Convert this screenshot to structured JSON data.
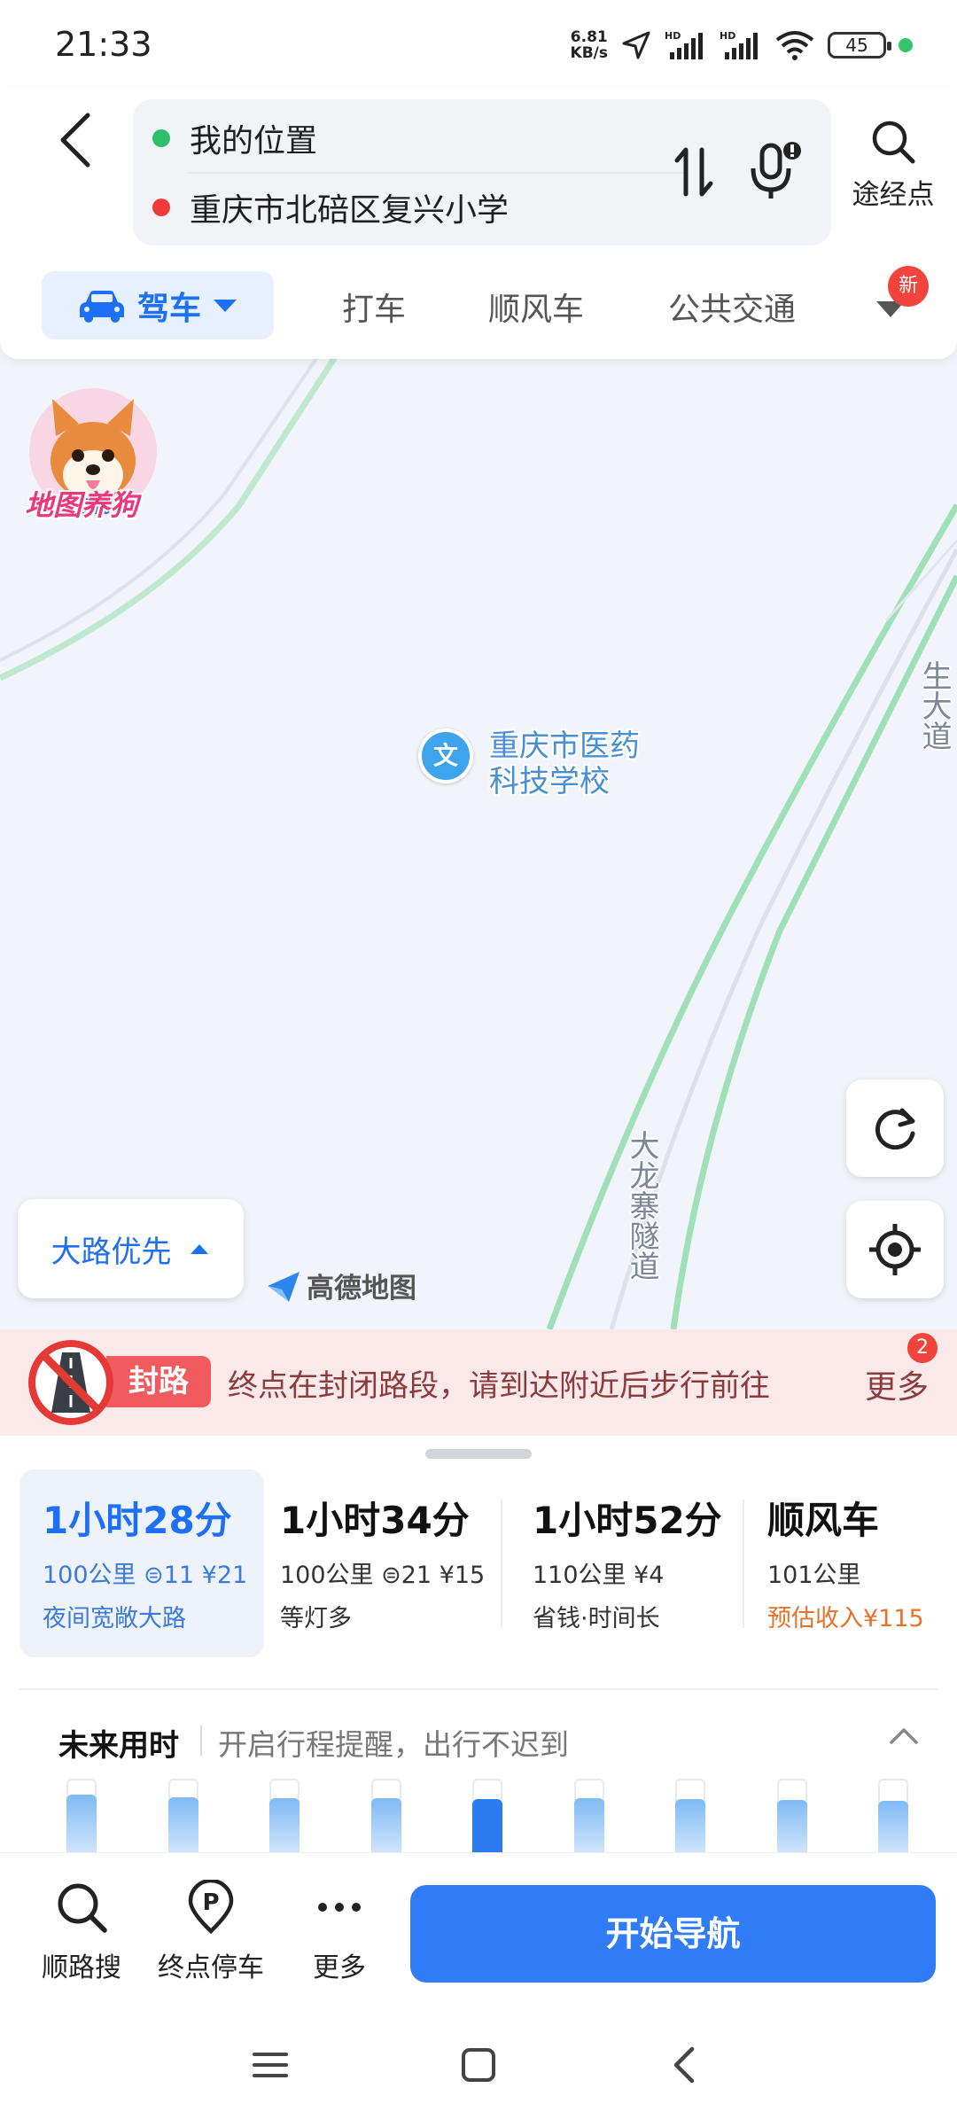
{
  "status_bar": {
    "time": "21:33",
    "net_speed_value": "6.81",
    "net_speed_unit": "KB/s",
    "battery": "45"
  },
  "header": {
    "from": "我的位置",
    "to": "重庆市北碚区复兴小学",
    "waypoint_label": "途经点",
    "colors": {
      "from_dot": "#2dbf6a",
      "to_dot": "#ef3b3b",
      "accent": "#1d6ff3"
    }
  },
  "modes": {
    "active": "驾车",
    "tabs": [
      "打车",
      "顺风车",
      "公共交通"
    ],
    "new_badge": "新"
  },
  "map": {
    "mascot_label": "地图养狗",
    "poi_icon_char": "文",
    "poi_name": "重庆市医药科技学校",
    "road_label_1": "大龙寨隧道",
    "road_label_2": "生大道",
    "road_pref": "大路优先",
    "logo": "高德地图"
  },
  "closure": {
    "tag": "封路",
    "text": "终点在封闭路段，请到达附近后步行前往",
    "more": "更多",
    "count": "2"
  },
  "routes": [
    {
      "time": "1小时28分",
      "info": "100公里 ⊜11 ¥21",
      "note": "夜间宽敞大路"
    },
    {
      "time": "1小时34分",
      "info": "100公里 ⊜21 ¥15",
      "note": "等灯多"
    },
    {
      "time": "1小时52分",
      "info": "110公里 ¥4",
      "note": "省钱·时间长"
    },
    {
      "time": "顺风车",
      "info": "101公里",
      "note": "预估收入¥115"
    }
  ],
  "future": {
    "title": "未来用时",
    "hint": "开启行程提醒，出行不迟到",
    "bar_levels": [
      0.78,
      0.75,
      0.74,
      0.74,
      0.72,
      0.74,
      0.72,
      0.71,
      0.7
    ],
    "selected_index": 4
  },
  "actions": {
    "search_along": "顺路搜",
    "parking": "终点停车",
    "more": "更多",
    "start": "开始导航"
  }
}
